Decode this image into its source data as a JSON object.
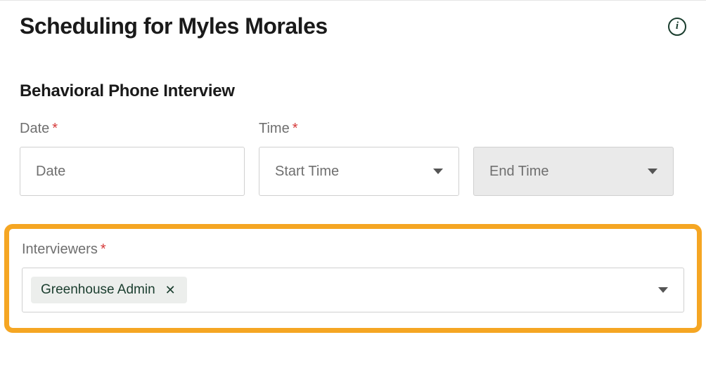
{
  "header": {
    "title": "Scheduling for Myles Morales"
  },
  "section": {
    "title": "Behavioral Phone Interview"
  },
  "fields": {
    "date": {
      "label": "Date",
      "placeholder": "Date"
    },
    "time": {
      "label": "Time",
      "start_placeholder": "Start Time",
      "end_placeholder": "End Time"
    },
    "interviewers": {
      "label": "Interviewers",
      "selected": [
        {
          "name": "Greenhouse Admin"
        }
      ]
    }
  },
  "required_mark": "*"
}
